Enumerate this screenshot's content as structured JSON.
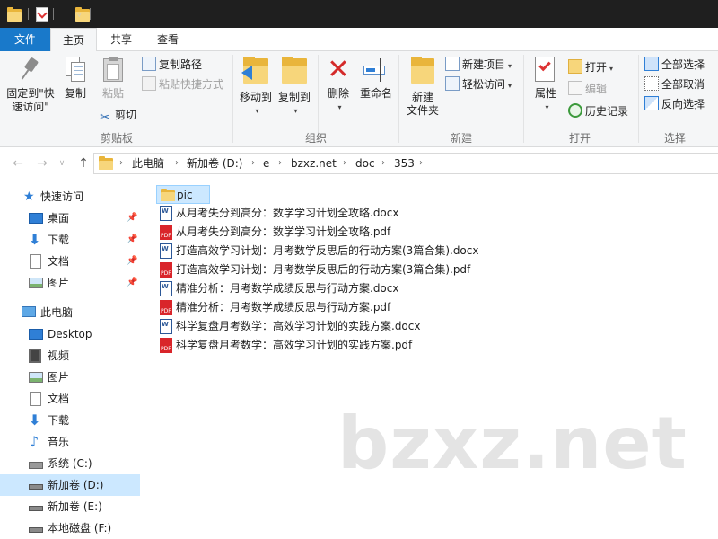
{
  "title_bar": {
    "quick_access_icons": [
      "folder-icon",
      "properties-icon",
      "new-folder-icon"
    ]
  },
  "tabs": {
    "file": "文件",
    "home": "主页",
    "share": "共享",
    "view": "查看"
  },
  "ribbon": {
    "clipboard": {
      "label": "剪贴板",
      "pin_label_1": "固定到\"快",
      "pin_label_2": "速访问\"",
      "copy": "复制",
      "paste": "粘贴",
      "copy_path": "复制路径",
      "paste_shortcut": "粘贴快捷方式",
      "cut": "剪切"
    },
    "organize": {
      "label": "组织",
      "move_to": "移动到",
      "copy_to": "复制到",
      "delete": "删除",
      "rename": "重命名"
    },
    "new": {
      "label": "新建",
      "new_folder_1": "新建",
      "new_folder_2": "文件夹",
      "new_item": "新建项目",
      "easy_access": "轻松访问"
    },
    "open": {
      "label": "打开",
      "properties": "属性",
      "open": "打开",
      "edit": "编辑",
      "history": "历史记录"
    },
    "select": {
      "label": "选择",
      "select_all": "全部选择",
      "select_none": "全部取消",
      "invert": "反向选择"
    }
  },
  "address": {
    "crumbs": [
      "此电脑",
      "新加卷 (D:)",
      "e",
      "bzxz.net",
      "doc",
      "353"
    ]
  },
  "navpane": {
    "quick_access": "快速访问",
    "quick_items": [
      "桌面",
      "下载",
      "文档",
      "图片"
    ],
    "this_pc": "此电脑",
    "pc_items": [
      "Desktop",
      "视频",
      "图片",
      "文档",
      "下载",
      "音乐",
      "系统 (C:)",
      "新加卷 (D:)",
      "新加卷 (E:)",
      "本地磁盘 (F:)"
    ]
  },
  "files": [
    {
      "name": "pic",
      "type": "folder"
    },
    {
      "name": "从月考失分到高分：数学学习计划全攻略.docx",
      "type": "docx"
    },
    {
      "name": "从月考失分到高分：数学学习计划全攻略.pdf",
      "type": "pdf"
    },
    {
      "name": "打造高效学习计划：月考数学反思后的行动方案(3篇合集).docx",
      "type": "docx"
    },
    {
      "name": "打造高效学习计划：月考数学反思后的行动方案(3篇合集).pdf",
      "type": "pdf"
    },
    {
      "name": "精准分析：月考数学成绩反思与行动方案.docx",
      "type": "docx"
    },
    {
      "name": "精准分析：月考数学成绩反思与行动方案.pdf",
      "type": "pdf"
    },
    {
      "name": "科学复盘月考数学：高效学习计划的实践方案.docx",
      "type": "docx"
    },
    {
      "name": "科学复盘月考数学：高效学习计划的实践方案.pdf",
      "type": "pdf"
    }
  ],
  "watermark": "bzxz.net",
  "colors": {
    "accent": "#1979ca",
    "selection": "#cce8ff",
    "folder": "#f7d67b"
  }
}
